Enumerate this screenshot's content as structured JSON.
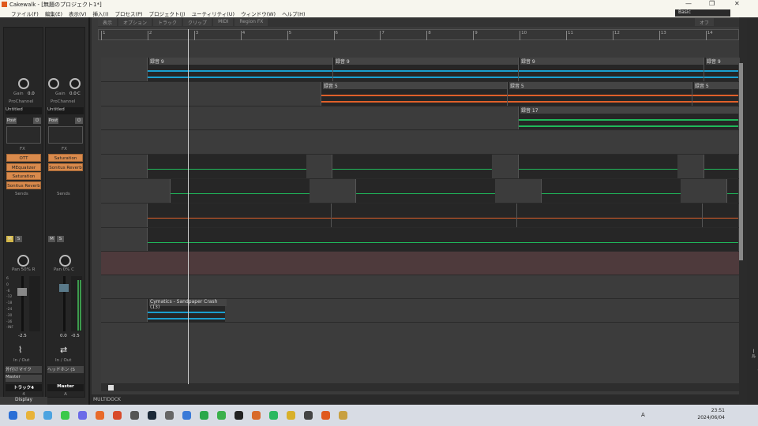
{
  "window": {
    "title": "Cakewalk - [無題のプロジェクト1*]",
    "workspace": "Basic"
  },
  "menu": [
    "ファイル(F)",
    "編集(E)",
    "表示(V)",
    "挿入(I)",
    "プロセス(P)",
    "プロジェクト(J)",
    "ユーティリティ(U)",
    "ウィンドウ(W)",
    "ヘルプ(H)"
  ],
  "toolbar": [
    "表示",
    "オプション",
    "トラック",
    "クリップ",
    "MIDI",
    "Region FX"
  ],
  "snap_label": "オフ",
  "ruler": [
    "1",
    "2",
    "3",
    "4",
    "5",
    "6",
    "7",
    "8",
    "9",
    "10",
    "11",
    "12",
    "13",
    "14"
  ],
  "strips": [
    {
      "gain_label": "Gain",
      "gain": "0.0",
      "prochannel": "ProChannel",
      "preset": "Untitled",
      "post": "Post",
      "fx_label": "FX",
      "fx": [
        "OTT",
        "MEqualizer",
        "Saturation Knob",
        "Sonitus Reverb"
      ],
      "sends": "Sends",
      "pan": "Pan 50% R",
      "vol": "-2.5",
      "io": "In / Out",
      "input": "外付けマイク",
      "output": "Master",
      "name": "トラック4",
      "number": "4",
      "scale": [
        "6",
        "0",
        "-6",
        "-12",
        "-18",
        "-24",
        "-30",
        "-36",
        "-INF"
      ]
    },
    {
      "gain_label": "Gain",
      "gain": "0.0",
      "pan_label": "Pan",
      "pan_top": "C",
      "prochannel": "ProChannel",
      "preset": "Untitled",
      "post": "Post",
      "fx_label": "FX",
      "fx": [
        "Saturation Knob",
        "Sonitus Reverb"
      ],
      "sends": "Sends",
      "pan": "Pan 0% C",
      "vol": "0.0",
      "peak": "-0.5",
      "io": "In / Out",
      "output": "ヘッドホン (S",
      "name": "Master",
      "number": "A"
    }
  ],
  "clips": {
    "rec9": "録音 9",
    "rec5": "録音 5",
    "rec17": "録音 17",
    "cymatics": "Cymatics - Sandpaper Crash (13)"
  },
  "display_label": "Display",
  "multidock": "MULTIDOCK",
  "sidebar_right": "ブラウザ | ヘルプモジュール",
  "colors": {
    "audio_blue": "#1a9fd0",
    "audio_orange": "#e0602a",
    "audio_green": "#1fb85a",
    "fx_orange": "#d98a4c"
  },
  "taskbar": {
    "time": "23:51",
    "date": "2024/06/04",
    "ime": "A"
  }
}
